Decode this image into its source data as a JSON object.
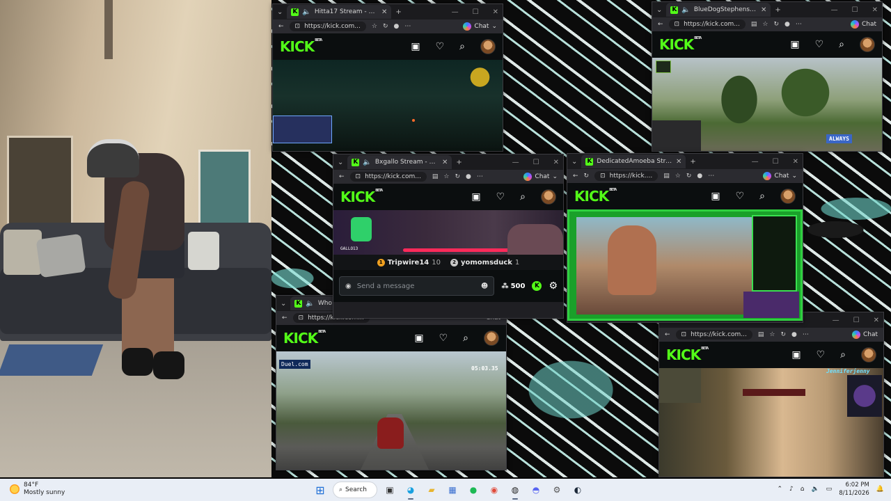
{
  "webcam": {},
  "windows": {
    "hitta": {
      "tab_title": "Hitta17 Stream - Watch Live o",
      "url": "https://kick.com...",
      "chat": "Chat",
      "logo": "KICK",
      "beta": "BETA"
    },
    "bluedog": {
      "tab_title": "BlueDogStephens Stream - W",
      "url": "https://kick.com...",
      "chat": "Chat",
      "logo": "KICK",
      "beta": "BETA",
      "overlay": "ALWAYS"
    },
    "bxgallo": {
      "tab_title": "Bxgallo Stream - Watch Live o",
      "url": "https://kick.com...",
      "chat": "Chat",
      "logo": "KICK",
      "beta": "BETA",
      "leader1_name": "Tripwire14",
      "leader1_count": "10",
      "leader1_rank": "1",
      "leader2_name": "yomomsduck",
      "leader2_count": "1",
      "leader2_rank": "2",
      "message_placeholder": "Send a message",
      "points": "500",
      "overlay_name": "GALLO13"
    },
    "amoeba": {
      "tab_title": "DedicatedAmoeba Stream - W",
      "url": "https://kick....",
      "chat": "Chat",
      "logo": "KICK",
      "beta": "BETA"
    },
    "who": {
      "tab_title": "Who",
      "url": "https://kick.com...",
      "chat": "Chat",
      "logo": "KICK",
      "beta": "BETA",
      "timer": "05:03.35",
      "sponsor": "Duel.com"
    },
    "jennifer": {
      "url": "https://kick.com...",
      "chat": "Chat",
      "logo": "KICK",
      "beta": "BETA",
      "overlay": "Jenniferjenny"
    }
  },
  "taskbar": {
    "temperature": "84°F",
    "condition": "Mostly sunny",
    "search_label": "Search",
    "time": "6:02 PM",
    "date": "8/11/2026",
    "icons": [
      "windows-start-icon",
      "search-icon",
      "task-view-icon",
      "edge-icon",
      "file-explorer-icon",
      "store-icon",
      "spotify-icon",
      "chrome-icon",
      "obs-icon",
      "discord-icon",
      "settings-icon",
      "steam-icon"
    ]
  }
}
